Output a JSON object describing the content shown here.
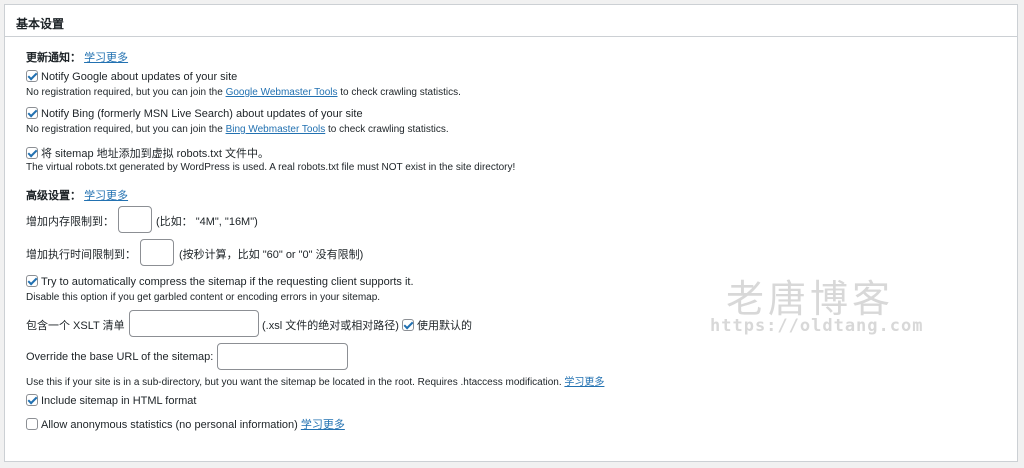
{
  "panel": {
    "title": "基本设置"
  },
  "update_notify": {
    "label": "更新通知：",
    "learn_more": "学习更多",
    "google": {
      "checked": true,
      "label": "Notify Google about updates of your site",
      "desc_prefix": "No registration required, but you can join the ",
      "link": "Google Webmaster Tools",
      "desc_suffix": " to check crawling statistics."
    },
    "bing": {
      "checked": true,
      "label": "Notify Bing (formerly MSN Live Search) about updates of your site",
      "desc_prefix": "No registration required, but you can join the ",
      "link": "Bing Webmaster Tools",
      "desc_suffix": " to check crawling statistics."
    },
    "robots": {
      "checked": true,
      "label": "将 sitemap 地址添加到虚拟 robots.txt 文件中。",
      "desc": "The virtual robots.txt generated by WordPress is used. A real robots.txt file must NOT exist in the site directory!"
    }
  },
  "advanced": {
    "label": "高级设置：",
    "learn_more": "学习更多",
    "memory": {
      "label": "增加内存限制到：",
      "value": "",
      "hint": "(比如： \"4M\", \"16M\")"
    },
    "time": {
      "label": "增加执行时间限制到：",
      "value": "",
      "hint": "(按秒计算，比如 \"60\" or \"0\" 没有限制)"
    },
    "compress": {
      "checked": true,
      "label": "Try to automatically compress the sitemap if the requesting client supports it.",
      "desc": "Disable this option if you get garbled content or encoding errors in your sitemap."
    },
    "xslt": {
      "label": "包含一个 XSLT 清单",
      "value": "",
      "hint": "(.xsl 文件的绝对或相对路径)",
      "default_checked": true,
      "default_label": "使用默认的"
    },
    "base_url": {
      "label": "Override the base URL of the sitemap:",
      "value": "",
      "desc": "Use this if your site is in a sub-directory, but you want the sitemap be located in the root. Requires .htaccess modification.",
      "learn_more": "学习更多"
    },
    "html_format": {
      "checked": true,
      "label": "Include sitemap in HTML format"
    },
    "anon_stats": {
      "checked": false,
      "label": "Allow anonymous statistics (no personal information)",
      "learn_more": "学习更多"
    }
  },
  "watermark": {
    "name": "老唐博客",
    "url": "https://oldtang.com"
  }
}
